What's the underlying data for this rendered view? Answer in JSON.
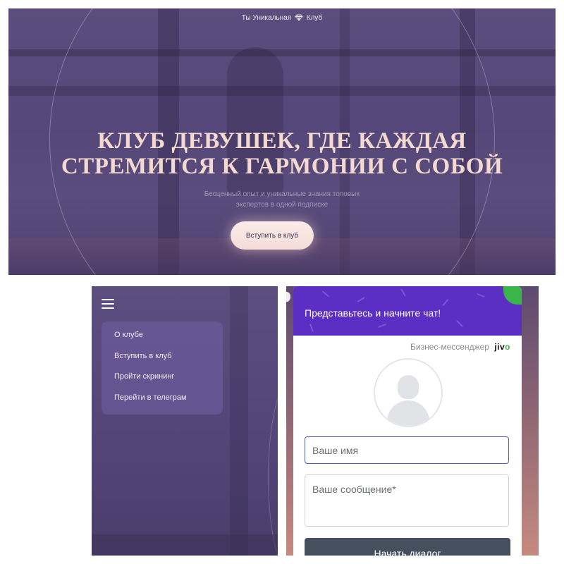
{
  "hero": {
    "brand_left": "Ты Уникальная",
    "brand_right": "Клуб",
    "title_line1": "КЛУБ ДЕВУШЕК, ГДЕ КАЖДАЯ",
    "title_line2": "СТРЕМИТСЯ К ГАРМОНИИ С СОБОЙ",
    "subtitle_line1": "Бесценный опыт и уникальные знания топовых",
    "subtitle_line2": "экспертов в одной подписке",
    "cta_label": "Вступить в клуб",
    "colors": {
      "background": "#56477a",
      "title": "#f4d9d0",
      "cta_bg": "#fbece9"
    }
  },
  "menu": {
    "icon": "hamburger-menu-icon",
    "items": [
      {
        "label": "О клубе"
      },
      {
        "label": "Вступить в клуб"
      },
      {
        "label": "Пройти скрининг"
      },
      {
        "label": "Перейти в телеграм"
      }
    ]
  },
  "chat": {
    "header_title": "Представьтесь и начните чат!",
    "powered_by": "Бизнес-мессенджер",
    "logo_text_main": "jiv",
    "logo_text_accent": "o",
    "name_placeholder": "Ваше имя",
    "message_placeholder": "Ваше сообщение*",
    "start_button": "Начать диалог",
    "colors": {
      "header": "#5c2fc4",
      "button": "#45505f",
      "accent": "#3ab54a"
    }
  }
}
